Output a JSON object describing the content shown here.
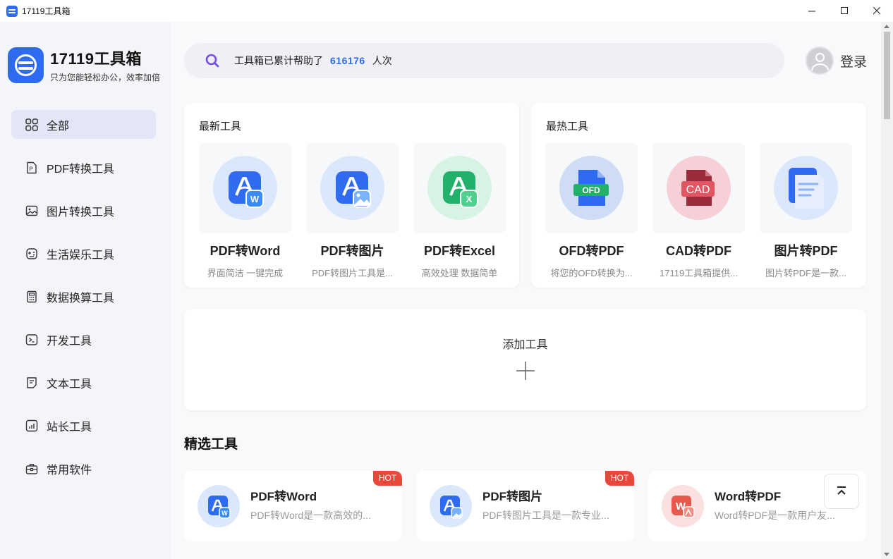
{
  "window": {
    "title": "17119工具箱",
    "minimize": "–",
    "maximize": "☐",
    "close": "✕"
  },
  "brand": {
    "name": "17119工具箱",
    "slogan": "只为您能轻松办公，效率加倍"
  },
  "sidebar": {
    "items": [
      {
        "label": "全部",
        "icon": "grid-icon",
        "active": true
      },
      {
        "label": "PDF转换工具",
        "icon": "pdf-file-icon"
      },
      {
        "label": "图片转换工具",
        "icon": "image-icon"
      },
      {
        "label": "生活娱乐工具",
        "icon": "game-icon"
      },
      {
        "label": "数据换算工具",
        "icon": "calculator-icon"
      },
      {
        "label": "开发工具",
        "icon": "terminal-icon"
      },
      {
        "label": "文本工具",
        "icon": "text-file-icon"
      },
      {
        "label": "站长工具",
        "icon": "chart-icon"
      },
      {
        "label": "常用软件",
        "icon": "toolbox-icon"
      }
    ]
  },
  "search": {
    "text": "工具箱已累计帮助了",
    "count": "616176",
    "unit": "人次"
  },
  "header": {
    "login_label": "登录"
  },
  "latest": {
    "title": "最新工具",
    "tools": [
      {
        "name": "PDF转Word",
        "desc": "界面简洁 一键完成",
        "icon": "pdf-to-word-icon"
      },
      {
        "name": "PDF转图片",
        "desc": "PDF转图片工具是...",
        "icon": "pdf-to-image-icon"
      },
      {
        "name": "PDF转Excel",
        "desc": "高效处理 数据简单",
        "icon": "pdf-to-excel-icon"
      }
    ]
  },
  "hottest": {
    "title": "最热工具",
    "tools": [
      {
        "name": "OFD转PDF",
        "desc": "将您的OFD转换为...",
        "icon": "ofd-to-pdf-icon"
      },
      {
        "name": "CAD转PDF",
        "desc": "17119工具箱提供...",
        "icon": "cad-to-pdf-icon"
      },
      {
        "name": "图片转PDF",
        "desc": "图片转PDF是一款...",
        "icon": "image-to-pdf-icon"
      }
    ]
  },
  "add_tool": {
    "label": "添加工具"
  },
  "featured": {
    "title": "精选工具",
    "items": [
      {
        "name": "PDF转Word",
        "desc": "PDF转Word是一款高效的...",
        "badge": "HOT"
      },
      {
        "name": "PDF转图片",
        "desc": "PDF转图片工具是一款专业...",
        "badge": "HOT"
      },
      {
        "name": "Word转PDF",
        "desc": "Word转PDF是一款用户友..."
      }
    ]
  },
  "colors": {
    "accent": "#2f6bf0",
    "hot": "#e8483c",
    "excel_green": "#21b16a",
    "ofd_blue": "#2f6bf0",
    "cad_red": "#e25563"
  }
}
